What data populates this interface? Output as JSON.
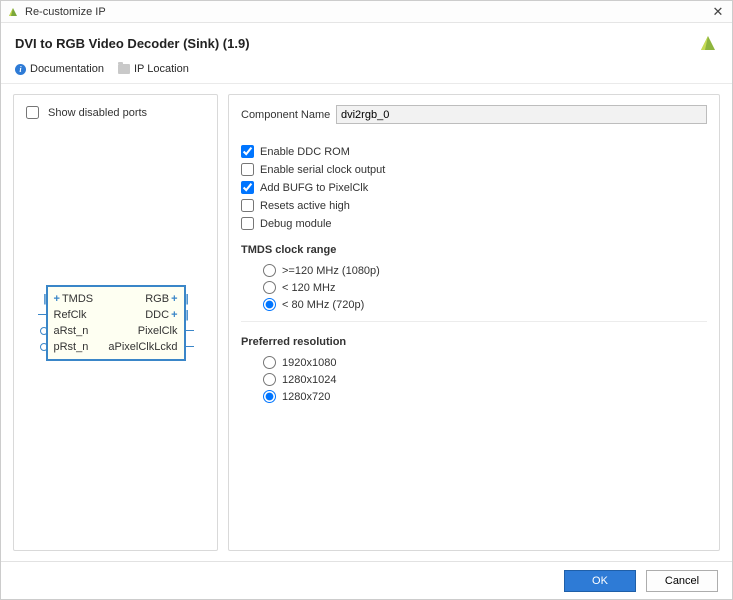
{
  "window": {
    "title": "Re-customize IP",
    "close_glyph": "✕"
  },
  "header": {
    "title": "DVI to RGB Video Decoder (Sink) (1.9)"
  },
  "links": {
    "documentation": "Documentation",
    "ip_location": "IP Location"
  },
  "left": {
    "show_disabled_label": "Show disabled ports",
    "ports_left": [
      "TMDS",
      "RefClk",
      "aRst_n",
      "pRst_n"
    ],
    "ports_right": [
      "RGB",
      "DDC",
      "PixelClk",
      "aPixelClkLckd"
    ]
  },
  "config": {
    "component_name_label": "Component Name",
    "component_name_value": "dvi2rgb_0",
    "checkboxes": [
      {
        "label": "Enable DDC ROM",
        "checked": true
      },
      {
        "label": "Enable serial clock output",
        "checked": false
      },
      {
        "label": "Add BUFG to PixelClk",
        "checked": true
      },
      {
        "label": "Resets active high",
        "checked": false
      },
      {
        "label": "Debug module",
        "checked": false
      }
    ],
    "tmds": {
      "heading": "TMDS clock range",
      "options": [
        {
          "label": ">=120 MHz (1080p)",
          "selected": false
        },
        {
          "label": "< 120 MHz",
          "selected": false
        },
        {
          "label": "< 80 MHz (720p)",
          "selected": true
        }
      ]
    },
    "resolution": {
      "heading": "Preferred resolution",
      "options": [
        {
          "label": "1920x1080",
          "selected": false
        },
        {
          "label": "1280x1024",
          "selected": false
        },
        {
          "label": "1280x720",
          "selected": true
        }
      ]
    }
  },
  "footer": {
    "ok": "OK",
    "cancel": "Cancel"
  }
}
